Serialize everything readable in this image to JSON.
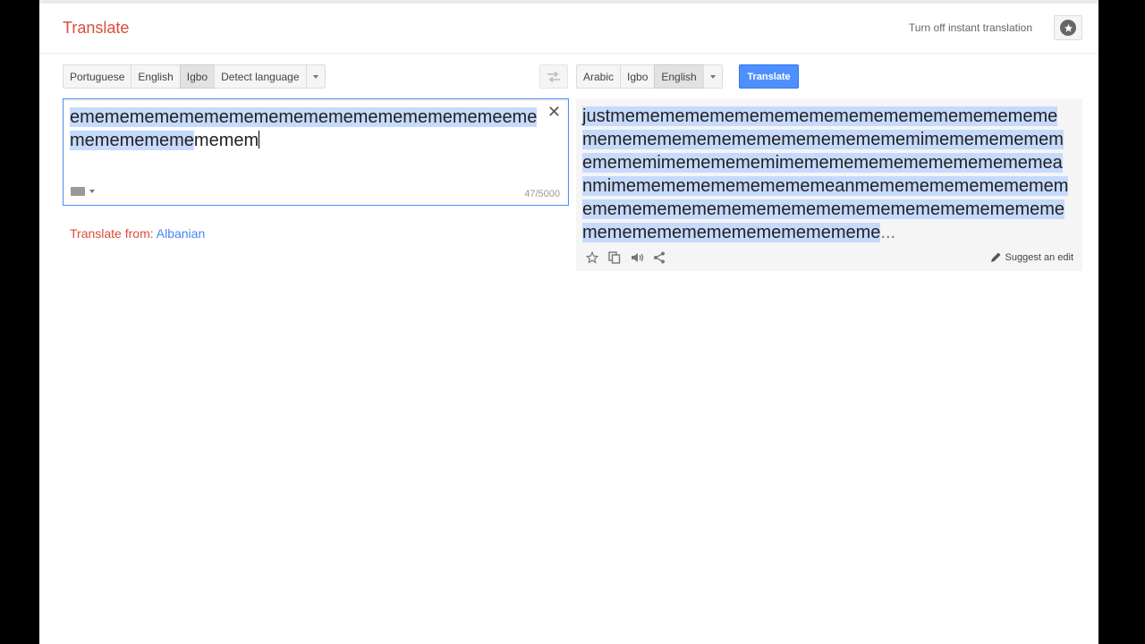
{
  "header": {
    "title": "Translate",
    "turn_off_label": "Turn off instant translation"
  },
  "source": {
    "languages": [
      "Portuguese",
      "English",
      "Igbo",
      "Detect language"
    ],
    "selected": "Igbo",
    "text_line1": "emememememememememememememememememeeme",
    "text_line2_selected": "mememememe",
    "text_line2_rest": "memem",
    "char_count": "47/5000",
    "translate_from_label": "Translate from: ",
    "detected_language": "Albanian"
  },
  "target": {
    "languages": [
      "Arabic",
      "Igbo",
      "English"
    ],
    "selected": "English",
    "translate_button": "Translate",
    "result_text": "justmemememememememememememememememememememememememememememememememimememememememememimememememimememememememememememeanmimememememememememeanmemememememememememememememememememememememememememememememememememememememememe",
    "ellipsis": "...",
    "suggest_label": "Suggest an edit"
  },
  "icons": {
    "star": "star-icon",
    "clear": "close-icon",
    "keyboard": "keyboard-icon",
    "swap": "swap-icon",
    "copy": "copy-icon",
    "listen": "speaker-icon",
    "share": "share-icon",
    "edit": "pencil-icon"
  },
  "colors": {
    "brand_red": "#dd4b39",
    "accent_blue": "#4d90fe",
    "link_blue": "#4285f4",
    "selection": "#c6dafc"
  }
}
